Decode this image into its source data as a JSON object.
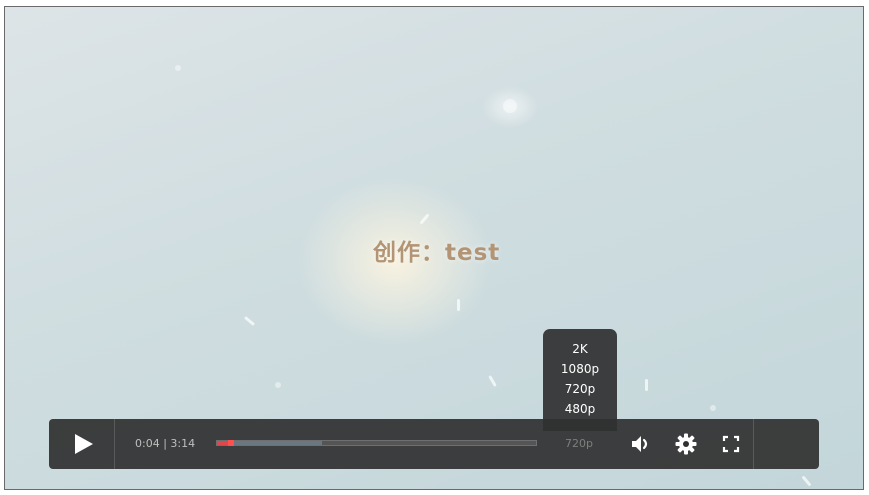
{
  "video": {
    "caption": "创作：test"
  },
  "quality_menu": {
    "options": [
      "2K",
      "1080p",
      "720p",
      "480p"
    ]
  },
  "controls": {
    "play_icon": "play-icon",
    "current_time": "0:04 | 3:14",
    "progress_played_fraction": 0.045,
    "progress_buffered_fraction": 0.33,
    "quality_label": "720p",
    "volume_icon": "volume-icon",
    "settings_icon": "gear-icon",
    "fullscreen_icon": "fullscreen-icon",
    "colors": {
      "played": "#e0474b",
      "buffered": "#6a7680",
      "bar_bg": "#303030"
    }
  }
}
